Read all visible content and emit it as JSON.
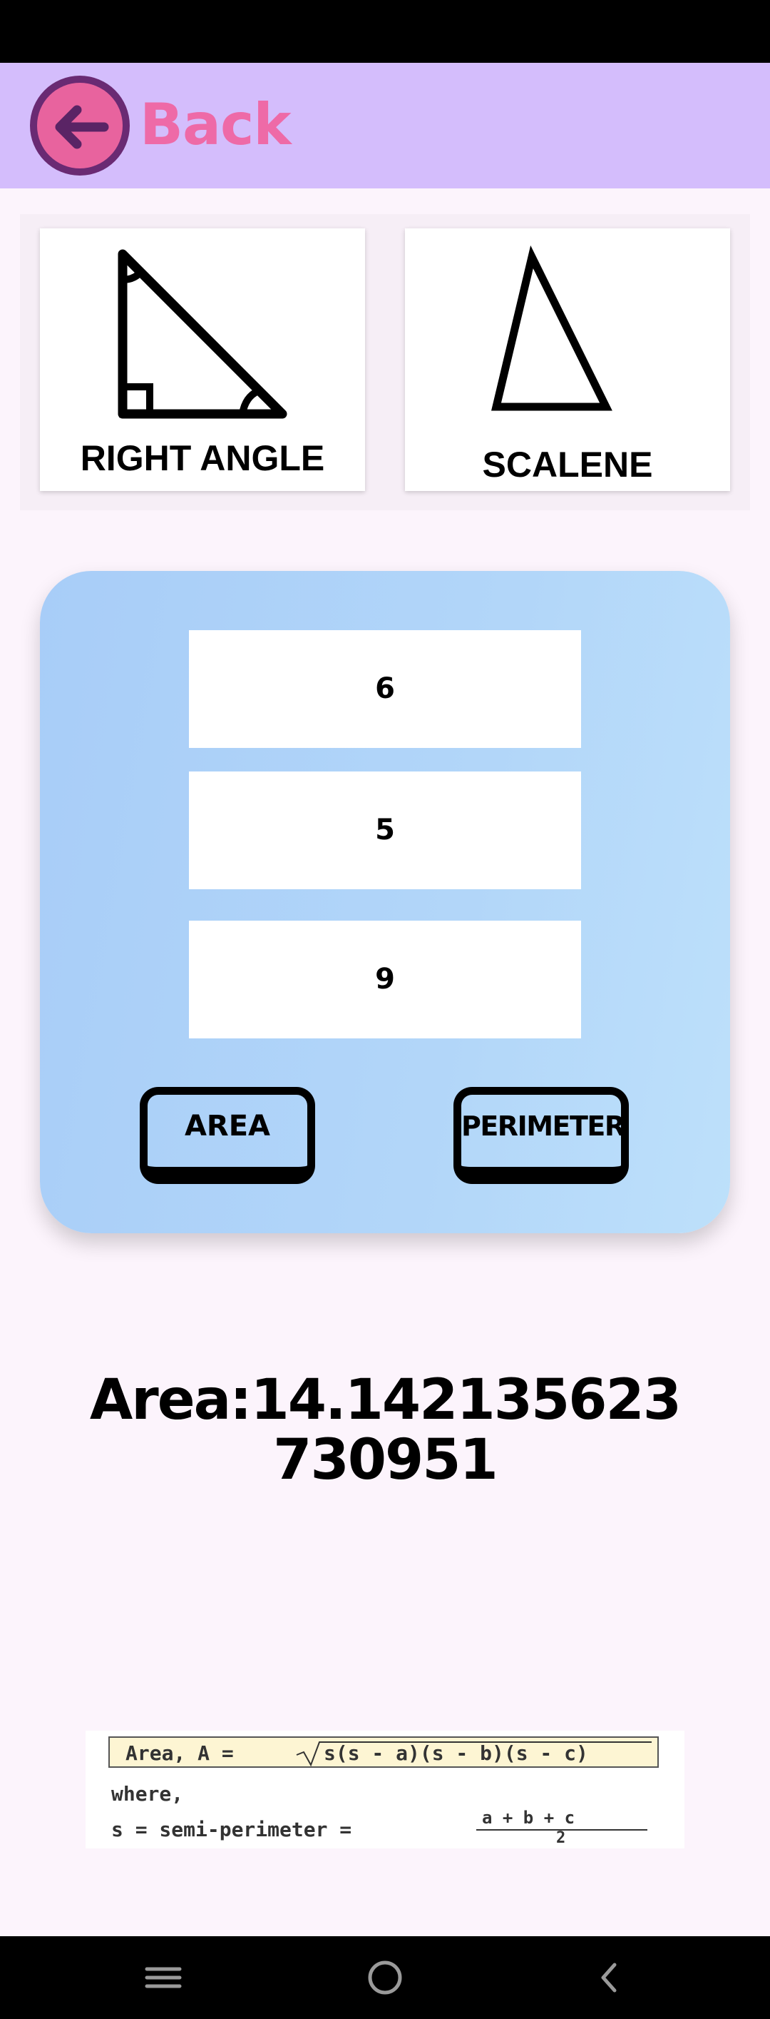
{
  "header": {
    "back_label": "Back"
  },
  "shapes": [
    {
      "label": "RIGHT ANGLE"
    },
    {
      "label": "SCALENE"
    }
  ],
  "inputs": {
    "side_a": "6",
    "side_b": "5",
    "side_c": "9"
  },
  "buttons": {
    "area": "AREA",
    "perimeter": "PERIMETER"
  },
  "result": "Area:14.142135623730951",
  "formula": {
    "area_label": "Area, A =",
    "radicand": "s(s - a)(s - b)(s - c)",
    "where": "where,",
    "semi": "s = semi-perimeter =",
    "numerator": "a + b + c",
    "denominator": "2"
  },
  "colors": {
    "header_bg": "#d4bdfc",
    "accent_pink": "#ee6aa7",
    "panel_blue": "#a8cdf8"
  }
}
